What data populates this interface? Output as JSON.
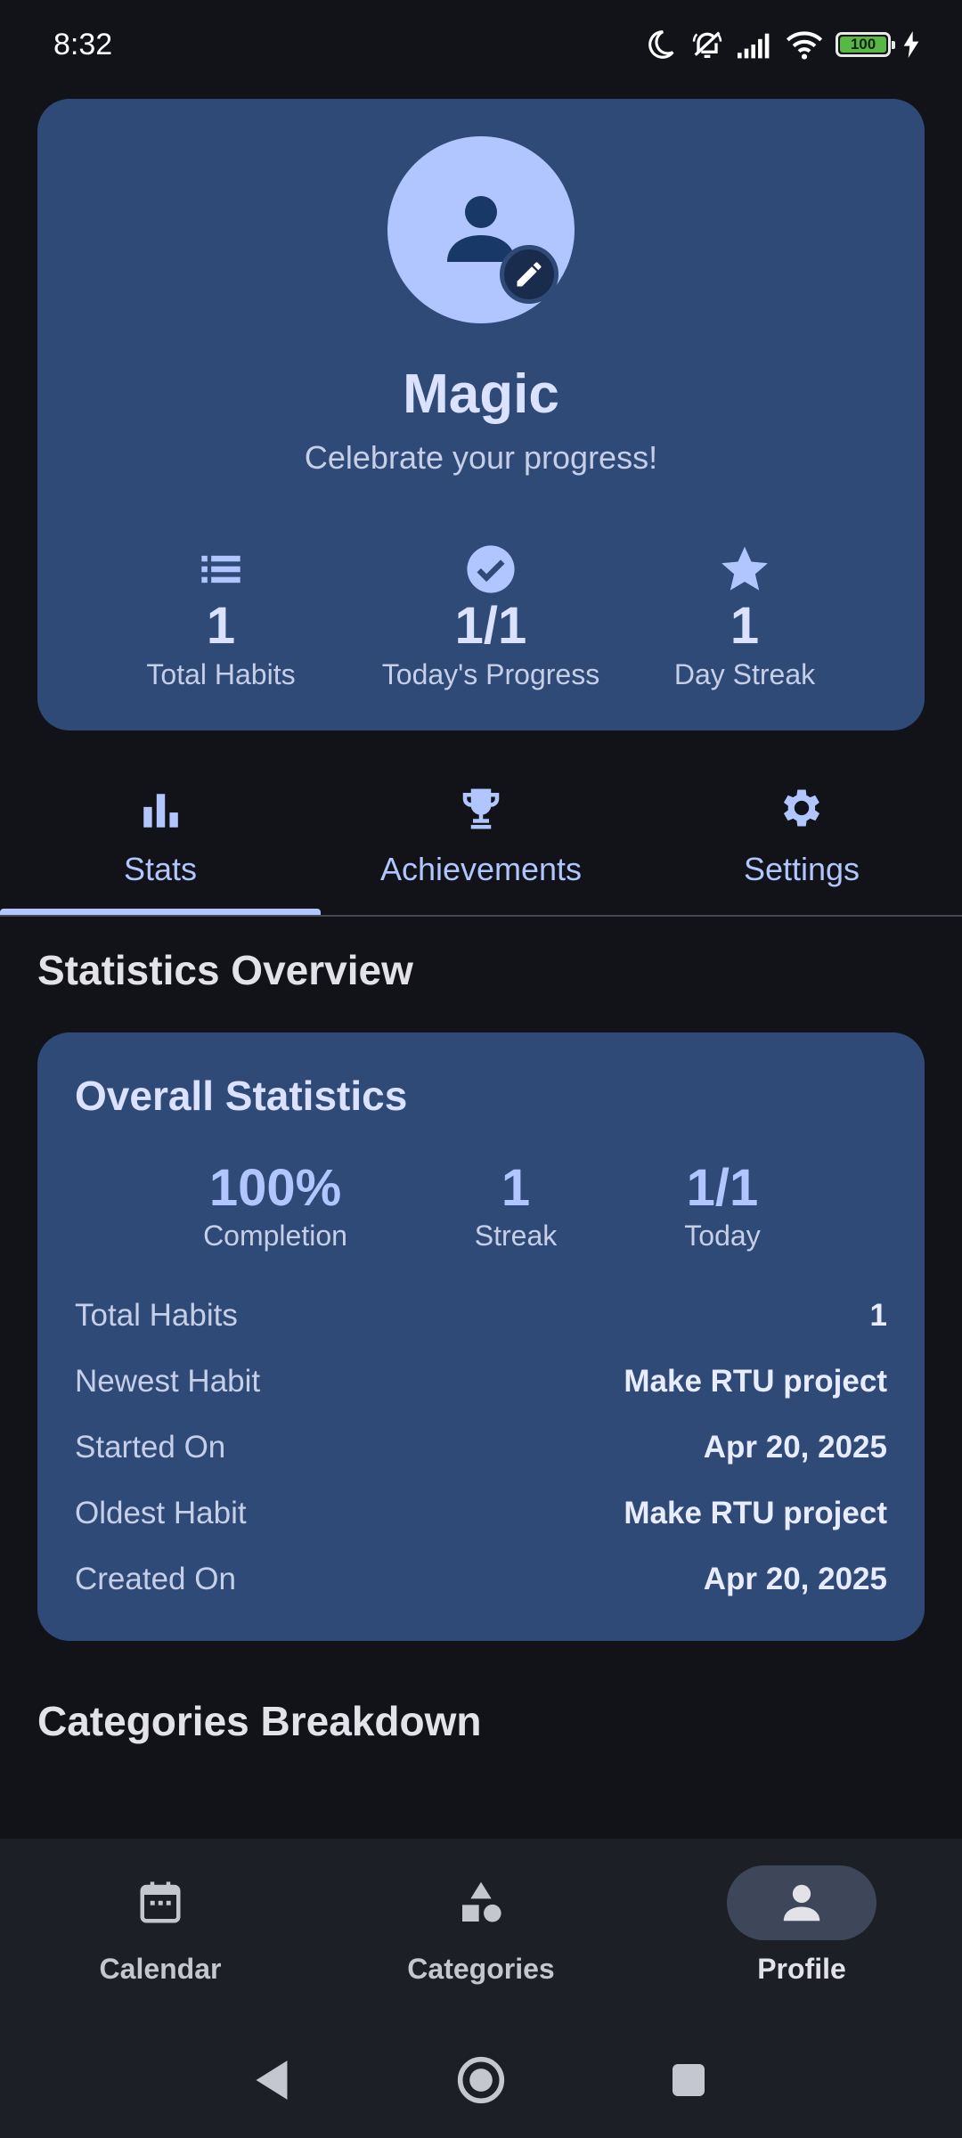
{
  "status_bar": {
    "time": "8:32",
    "battery": "100",
    "icons": [
      "moon-icon",
      "bell-off-icon",
      "signal-icon",
      "wifi-icon",
      "battery-icon",
      "charging-icon"
    ]
  },
  "profile": {
    "name": "Magic",
    "subtitle": "Celebrate your progress!",
    "stats": [
      {
        "icon": "list-icon",
        "value": "1",
        "label": "Total Habits"
      },
      {
        "icon": "check-circle-icon",
        "value": "1/1",
        "label": "Today's Progress"
      },
      {
        "icon": "star-icon",
        "value": "1",
        "label": "Day Streak"
      }
    ]
  },
  "tabs": [
    {
      "icon": "bar-chart-icon",
      "label": "Stats",
      "active": true
    },
    {
      "icon": "trophy-icon",
      "label": "Achievements",
      "active": false
    },
    {
      "icon": "gear-icon",
      "label": "Settings",
      "active": false
    }
  ],
  "stats_overview": {
    "title": "Statistics Overview",
    "card_title": "Overall Statistics",
    "metrics": [
      {
        "value": "100%",
        "label": "Completion"
      },
      {
        "value": "1",
        "label": "Streak"
      },
      {
        "value": "1/1",
        "label": "Today"
      }
    ],
    "details": [
      {
        "key": "Total Habits",
        "value": "1"
      },
      {
        "key": "Newest Habit",
        "value": "Make RTU project"
      },
      {
        "key": "Started On",
        "value": "Apr 20, 2025"
      },
      {
        "key": "Oldest Habit",
        "value": "Make RTU project"
      },
      {
        "key": "Created On",
        "value": "Apr 20, 2025"
      }
    ]
  },
  "categories_breakdown": {
    "title": "Categories Breakdown"
  },
  "bottom_nav": [
    {
      "icon": "calendar-icon",
      "label": "Calendar",
      "active": false
    },
    {
      "icon": "shapes-icon",
      "label": "Categories",
      "active": false
    },
    {
      "icon": "person-icon",
      "label": "Profile",
      "active": true
    }
  ],
  "colors": {
    "background": "#111318",
    "card": "#304a78",
    "accent": "#b1c5ff",
    "nav_bar": "#1d1f26"
  }
}
